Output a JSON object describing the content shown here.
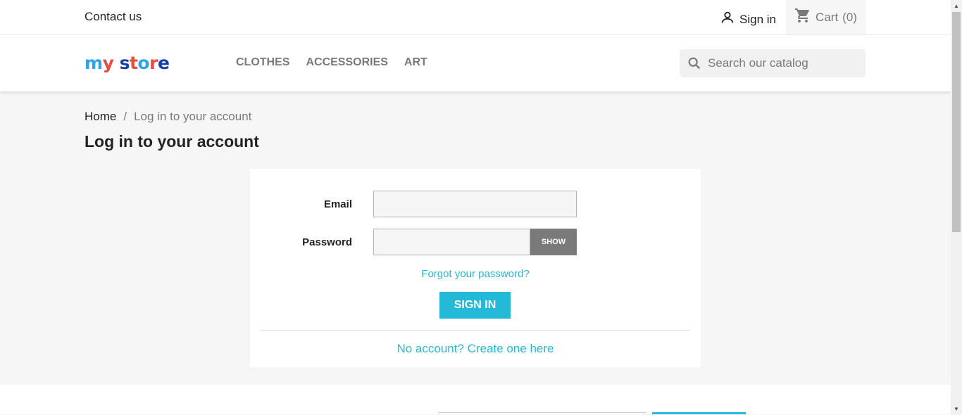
{
  "topbar": {
    "contact_label": "Contact us",
    "signin_label": "Sign in",
    "cart_label": "Cart",
    "cart_count": "(0)"
  },
  "header": {
    "logo_text": [
      "m",
      "y",
      " ",
      "s",
      "t",
      "o",
      "r",
      "e"
    ],
    "logo_colors": [
      "#2ea3f2",
      "#e84c3d",
      "#ffffff",
      "#1a3ea8",
      "#e84c3d",
      "#2ea3f2",
      "#e84c3d",
      "#1a3ea8"
    ],
    "nav": [
      "CLOTHES",
      "ACCESSORIES",
      "ART"
    ],
    "search_placeholder": "Search our catalog"
  },
  "breadcrumb": {
    "home": "Home",
    "separator": "/",
    "current": "Log in to your account"
  },
  "page_title": "Log in to your account",
  "form": {
    "email_label": "Email",
    "email_value": "",
    "password_label": "Password",
    "password_value": "",
    "show_label": "SHOW",
    "forgot_label": "Forgot your password?",
    "signin_button": "SIGN IN",
    "no_account_label": "No account? Create one here"
  },
  "colors": {
    "accent": "#24b9d7",
    "text": "#232323",
    "muted": "#7a7a7a"
  }
}
